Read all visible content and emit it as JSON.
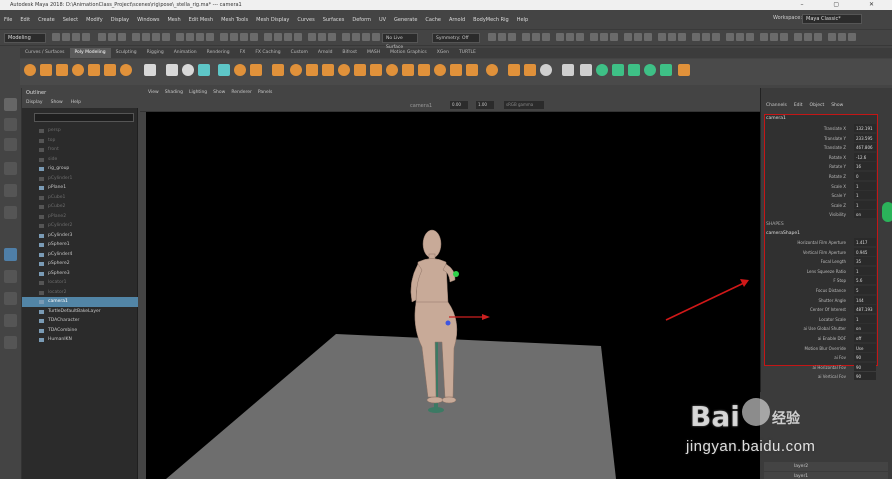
{
  "window": {
    "title": "Autodesk Maya 2018: D:\\AnimationClass_Project\\scenes\\rig\\pose\\_stella_rig.ma*  ---  camera1"
  },
  "menubar": {
    "items": [
      "File",
      "Edit",
      "Create",
      "Select",
      "Modify",
      "Display",
      "Windows",
      "Mesh",
      "Edit Mesh",
      "Mesh Tools",
      "Mesh Display",
      "Curves",
      "Surfaces",
      "Deform",
      "UV",
      "Generate",
      "Cache",
      "Arnold",
      "BodyMech Rig",
      "Help"
    ],
    "workspace_label": "Workspace:",
    "workspace_value": "Maya Classic*"
  },
  "statusline": {
    "mode": "Modeling",
    "live_surface": "No Live Surface",
    "symmetry": "Symmetry: Off"
  },
  "shelf": {
    "tabs": [
      "Curves / Surfaces",
      "Poly Modeling",
      "Sculpting",
      "Rigging",
      "Animation",
      "Rendering",
      "FX",
      "FX Caching",
      "Custom",
      "Arnold",
      "Bifrost",
      "MASH",
      "Motion Graphics",
      "XGen",
      "TURTLE"
    ],
    "active_tab": 1
  },
  "outliner": {
    "title": "Outliner",
    "menu": [
      "Display",
      "Show",
      "Help"
    ],
    "rows": [
      {
        "label": "persp",
        "dim": true
      },
      {
        "label": "top",
        "dim": true
      },
      {
        "label": "front",
        "dim": true
      },
      {
        "label": "side",
        "dim": true
      },
      {
        "label": "rig_group",
        "dim": false
      },
      {
        "label": "pCylinder1",
        "dim": true
      },
      {
        "label": "pPlane1",
        "dim": false
      },
      {
        "label": "pCube1",
        "dim": true
      },
      {
        "label": "pCube2",
        "dim": true
      },
      {
        "label": "pPlane2",
        "dim": true
      },
      {
        "label": "pCylinder2",
        "dim": true
      },
      {
        "label": "pCylinder3",
        "dim": false
      },
      {
        "label": "pSphere1",
        "dim": false
      },
      {
        "label": "pCylinder4",
        "dim": false
      },
      {
        "label": "pSphere2",
        "dim": false
      },
      {
        "label": "pSphere3",
        "dim": false
      },
      {
        "label": "locator1",
        "dim": true
      },
      {
        "label": "locator2",
        "dim": true
      },
      {
        "label": "camera1",
        "dim": false,
        "selected": true
      },
      {
        "label": "TurtleDefaultBakeLayer",
        "dim": false
      },
      {
        "label": "TDACharacter",
        "dim": false
      },
      {
        "label": "TDACombine",
        "dim": false
      },
      {
        "label": "HumanIKN",
        "dim": false
      }
    ]
  },
  "viewport": {
    "menu": [
      "View",
      "Shading",
      "Lighting",
      "Show",
      "Renderer",
      "Panels"
    ],
    "camera_label": "camera1",
    "field1": "0.00",
    "field2": "1.00",
    "colorspace": "sRGB gamma"
  },
  "channel_box": {
    "tabs": [
      "Channels",
      "Edit",
      "Object",
      "Show"
    ],
    "object_name": "camera1",
    "transform_attrs": [
      {
        "name": "Translate X",
        "value": "132.191"
      },
      {
        "name": "Translate Y",
        "value": "233.595"
      },
      {
        "name": "Translate Z",
        "value": "467.806"
      },
      {
        "name": "Rotate X",
        "value": "-12.6"
      },
      {
        "name": "Rotate Y",
        "value": "16"
      },
      {
        "name": "Rotate Z",
        "value": "0"
      },
      {
        "name": "Scale X",
        "value": "1"
      },
      {
        "name": "Scale Y",
        "value": "1"
      },
      {
        "name": "Scale Z",
        "value": "1"
      },
      {
        "name": "Visibility",
        "value": "on"
      }
    ],
    "shapes_label": "SHAPES",
    "shape_name": "cameraShape1",
    "shape_attrs": [
      {
        "name": "Horizontal Film Aperture",
        "value": "1.417"
      },
      {
        "name": "Vertical Film Aperture",
        "value": "0.945"
      },
      {
        "name": "Focal Length",
        "value": "35"
      },
      {
        "name": "Lens Squeeze Ratio",
        "value": "1"
      },
      {
        "name": "F Stop",
        "value": "5.6"
      },
      {
        "name": "Focus Distance",
        "value": "5"
      },
      {
        "name": "Shutter Angle",
        "value": "144"
      },
      {
        "name": "Center Of Interest",
        "value": "487.193"
      },
      {
        "name": "Locator Scale",
        "value": "1"
      },
      {
        "name": "ai Use Global Shutter",
        "value": "on"
      },
      {
        "name": "ai Enable DOF",
        "value": "off"
      },
      {
        "name": "Motion Blur Override",
        "value": "Use Globa"
      },
      {
        "name": "ai Fov",
        "value": "90"
      },
      {
        "name": "ai Horizontal Fov",
        "value": "90"
      },
      {
        "name": "ai Vertical Fov",
        "value": "90"
      }
    ]
  },
  "layers": {
    "rows": [
      "layer2",
      "layer1"
    ]
  },
  "watermark": {
    "brand": "Bai",
    "brand2": "经验",
    "url": "jingyan.baidu.com"
  },
  "colors": {
    "selection": "#5285a6",
    "highlight_box": "#c41616",
    "arrow": "#d01818",
    "shelf_orange": "#e0913a"
  }
}
